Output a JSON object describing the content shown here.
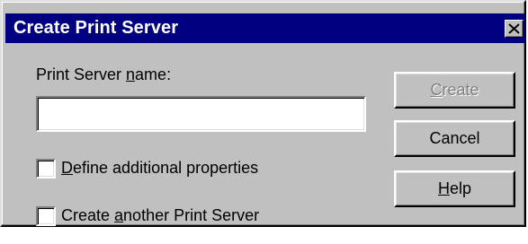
{
  "window": {
    "title": "Create Print Server",
    "close_icon": "close-icon"
  },
  "form": {
    "name_label_pre": "Print Server ",
    "name_label_key": "n",
    "name_label_post": "ame:",
    "name_value": ""
  },
  "options": [
    {
      "label_pre": "",
      "label_key": "D",
      "label_post": "efine additional properties",
      "checked": false
    },
    {
      "label_pre": "Create ",
      "label_key": "a",
      "label_post": "nother Print Server",
      "checked": false
    }
  ],
  "buttons": {
    "create": {
      "pre": "",
      "key": "C",
      "post": "reate",
      "enabled": false
    },
    "cancel": {
      "pre": "Cancel",
      "key": "",
      "post": "",
      "enabled": true
    },
    "help": {
      "pre": "",
      "key": "H",
      "post": "elp",
      "enabled": true
    }
  },
  "colors": {
    "titlebar": "#000080",
    "face": "#c0c0c0",
    "disabled_text": "#808080"
  }
}
